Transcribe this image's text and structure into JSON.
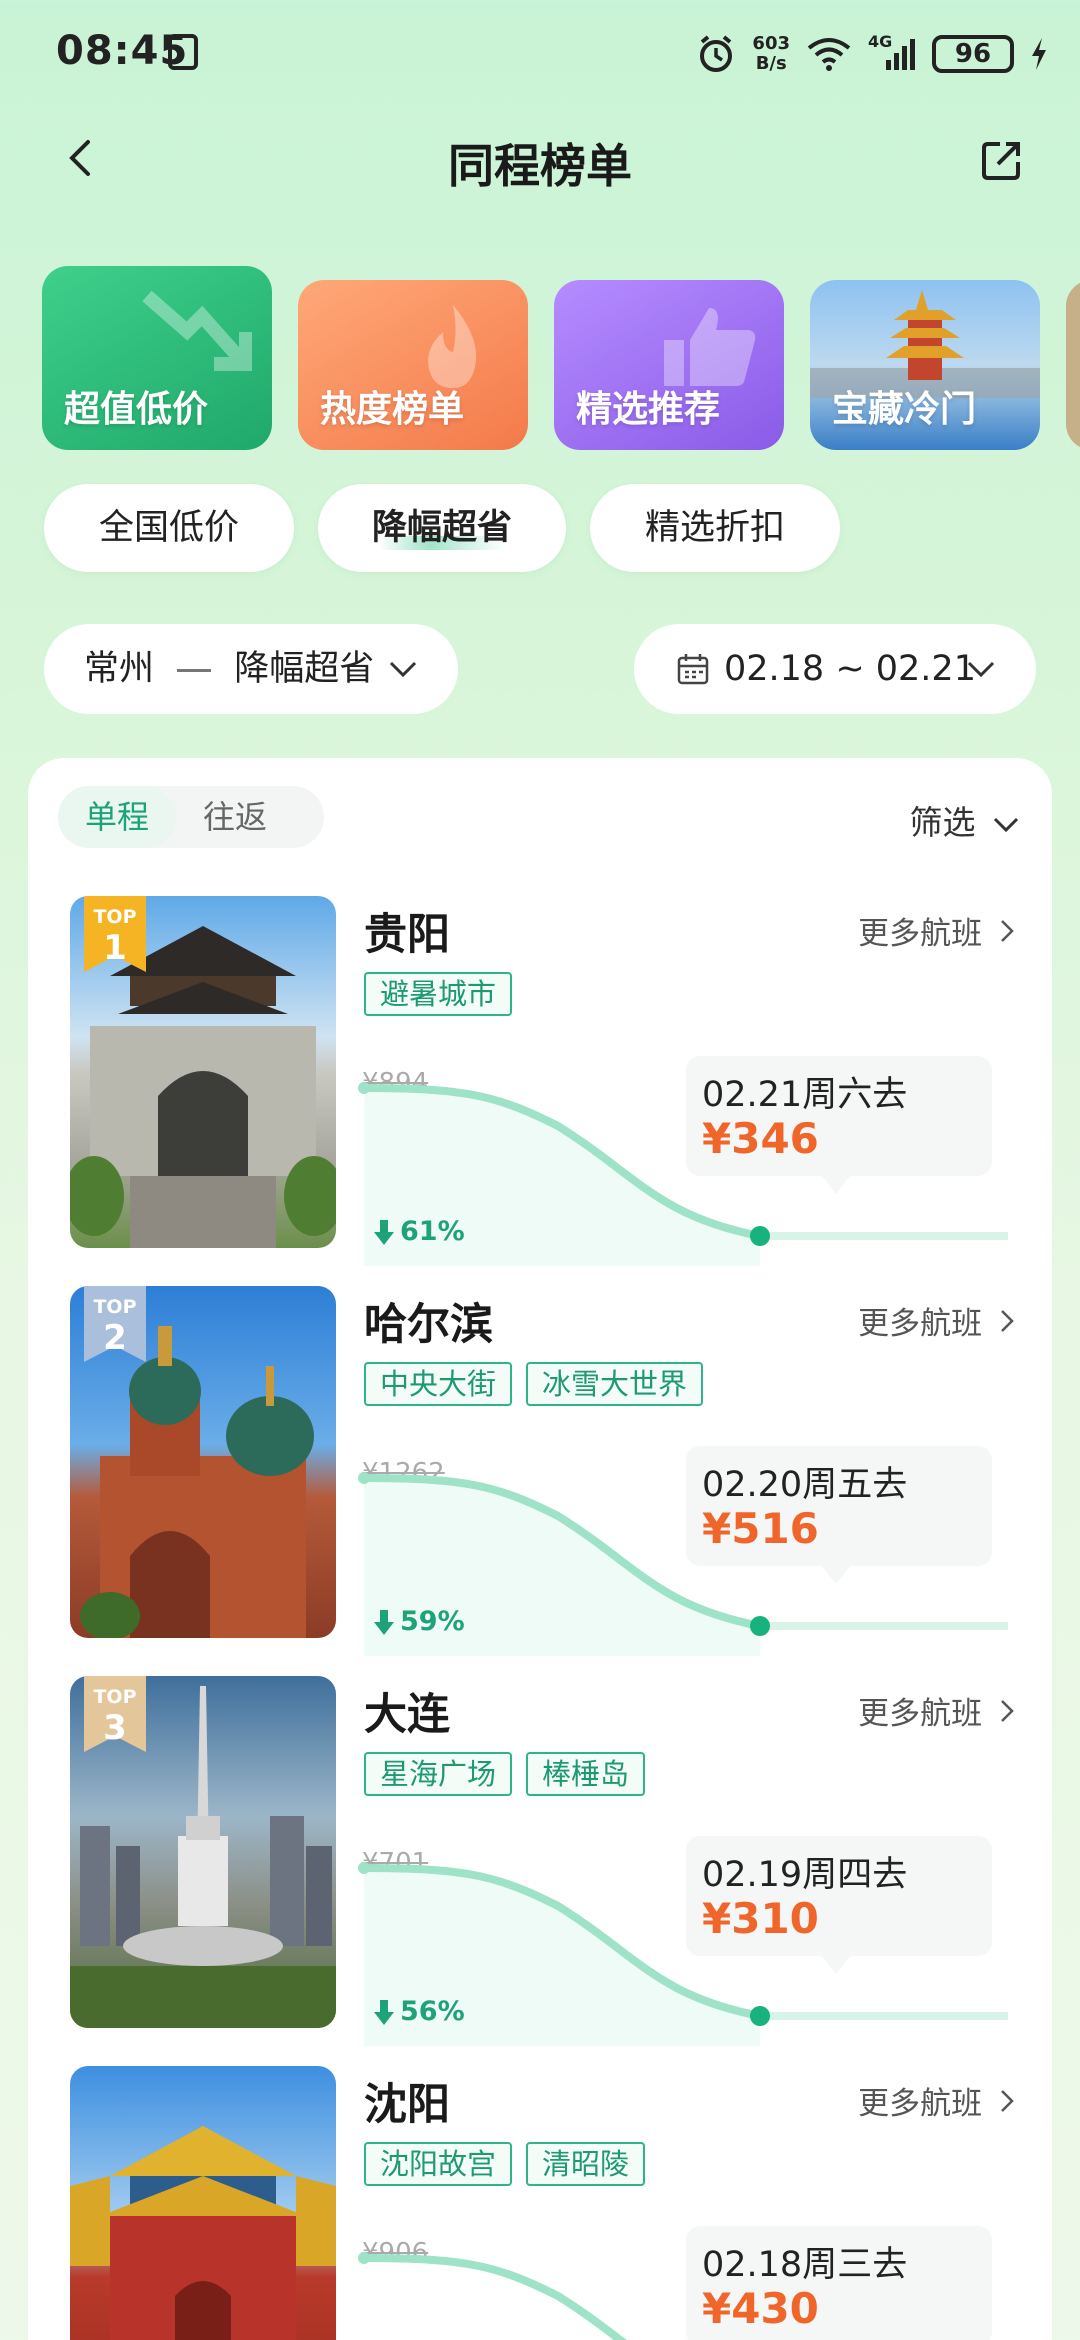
{
  "status": {
    "time": "08:45",
    "net_speed": "603",
    "net_unit": "B/s",
    "network": "4G",
    "battery": "96"
  },
  "header": {
    "title": "同程榜单"
  },
  "categories": [
    {
      "label": "超值低价",
      "color": "#27b679"
    },
    {
      "label": "热度榜单",
      "color": "#f7885a"
    },
    {
      "label": "精选推荐",
      "color": "#9d6bf0"
    },
    {
      "label": "宝藏冷门",
      "color": "#3c8fd8"
    }
  ],
  "pills": [
    {
      "label": "全国低价"
    },
    {
      "label": "降幅超省"
    },
    {
      "label": "精选折扣"
    }
  ],
  "selectors": {
    "route_from": "常州",
    "route_to": "降幅超省",
    "dates": "02.18 ~ 02.21"
  },
  "tabs": {
    "oneway": "单程",
    "roundtrip": "往返",
    "filter": "筛选"
  },
  "more_label": "更多航班",
  "destinations": [
    {
      "rank_label": "TOP",
      "rank": "1",
      "city": "贵阳",
      "tags": [
        "避暑城市"
      ],
      "original_price": "¥894",
      "date": "02.21周六去",
      "price": "¥346",
      "drop": "61%"
    },
    {
      "rank_label": "TOP",
      "rank": "2",
      "city": "哈尔滨",
      "tags": [
        "中央大街",
        "冰雪大世界"
      ],
      "original_price": "¥1262",
      "date": "02.20周五去",
      "price": "¥516",
      "drop": "59%"
    },
    {
      "rank_label": "TOP",
      "rank": "3",
      "city": "大连",
      "tags": [
        "星海广场",
        "棒棰岛"
      ],
      "original_price": "¥701",
      "date": "02.19周四去",
      "price": "¥310",
      "drop": "56%"
    },
    {
      "rank_label": "",
      "rank": "",
      "city": "沈阳",
      "tags": [
        "沈阳故宫",
        "清昭陵"
      ],
      "original_price": "¥906",
      "date": "02.18周三去",
      "price": "¥430",
      "drop": ""
    }
  ]
}
